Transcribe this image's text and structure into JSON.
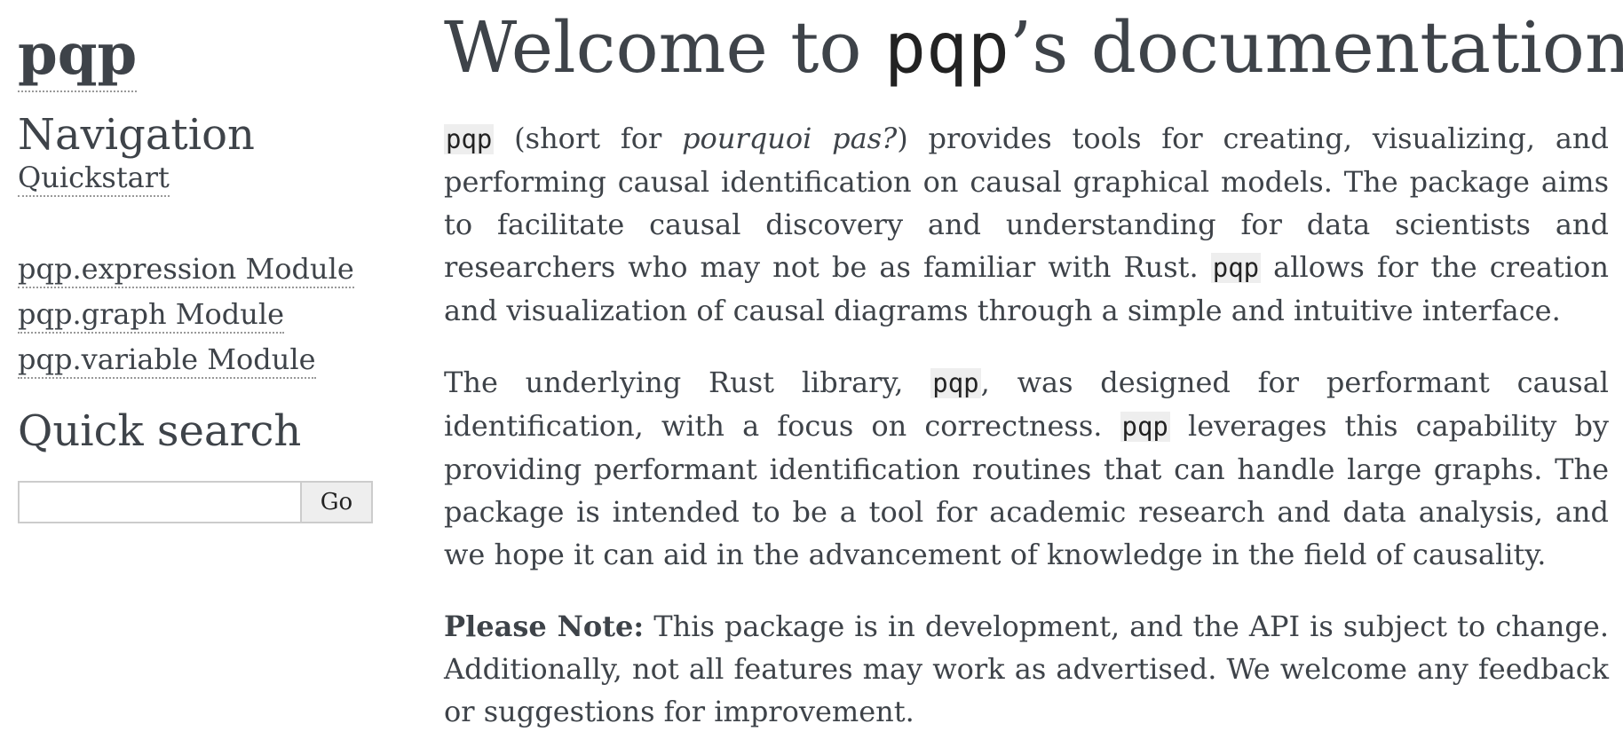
{
  "sidebar": {
    "logo": "pqp",
    "navigation_heading": "Navigation",
    "nav_links": [
      "Quickstart",
      "pqp.expression Module",
      "pqp.graph Module",
      "pqp.variable Module"
    ],
    "search_heading": "Quick search",
    "search_input_value": "",
    "search_button": "Go"
  },
  "main": {
    "title_prefix": "Welcome to ",
    "title_code": "pqp",
    "title_suffix": "’s documentation!",
    "p1": {
      "code1": "pqp",
      "text1": " (short for ",
      "em1": "pourquoi pas?",
      "text2": ") provides tools for creating, visualizing, and performing causal identification on causal graphical models. The package aims to facilitate causal discovery and understanding for data scientists and researchers who may not be as familiar with Rust. ",
      "code2": "pqp",
      "text3": " allows for the creation and visualization of causal diagrams through a simple and intuitive interface."
    },
    "p2": {
      "text1": "The underlying Rust library, ",
      "code1": "pqp",
      "text2": ", was designed for performant causal identification, with a focus on correctness. ",
      "code2": "pqp",
      "text3": " leverages this capability by providing performant identification routines that can handle large graphs. The package is intended to be a tool for academic research and data analysis, and we hope it can aid in the advancement of knowledge in the field of causality."
    },
    "p3": {
      "strong": "Please Note:",
      "text1": " This package is in development, and the API is subject to change. Additionally, not all features may work as advertised. We welcome any feedback or suggestions for improvement."
    }
  }
}
